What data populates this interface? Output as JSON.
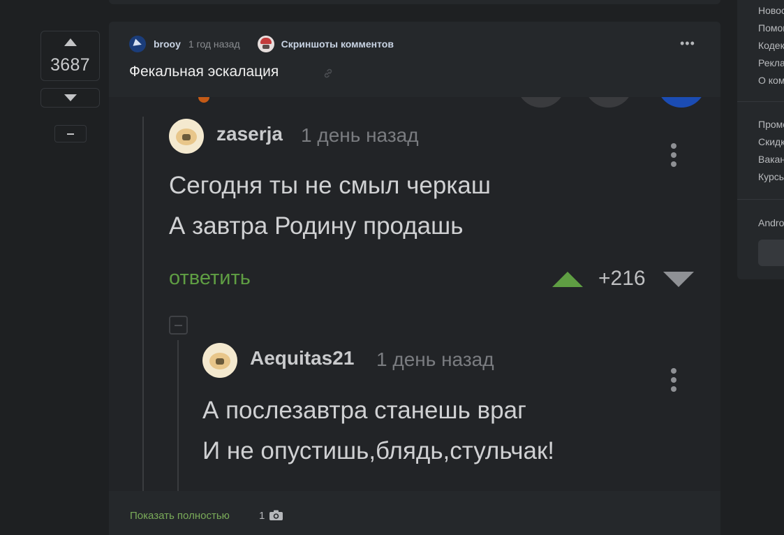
{
  "vote": {
    "rating": "3687"
  },
  "story": {
    "author": "brooy",
    "time": "1 год назад",
    "community": "Скриншоты комментов",
    "title": "Фекальная эскалация"
  },
  "screenshot": {
    "comment1": {
      "author": "zaserja",
      "time": "1 день назад",
      "line1": "Сегодня ты не смыл черкаш",
      "line2": "А завтра Родину продашь",
      "reply": "ответить",
      "score": "+216"
    },
    "comment2": {
      "author": "Aequitas21",
      "time": "1 день назад",
      "line1": "А послезавтра станешь враг",
      "line2": "И не опустишь,блядь,стульчак!"
    }
  },
  "footer": {
    "show_more": "Показать полностью",
    "image_count": "1"
  },
  "sidebar": {
    "items": [
      "Новости",
      "Помощь",
      "Кодекс",
      "Реклама",
      "О компании",
      "Промокоды",
      "Скидки",
      "Вакансии",
      "Курсы",
      "Android"
    ]
  },
  "colors": {
    "page_bg": "#1e2022",
    "card_bg": "#25282b",
    "accent_green": "#5f9e43",
    "link_green": "#7aab59"
  }
}
